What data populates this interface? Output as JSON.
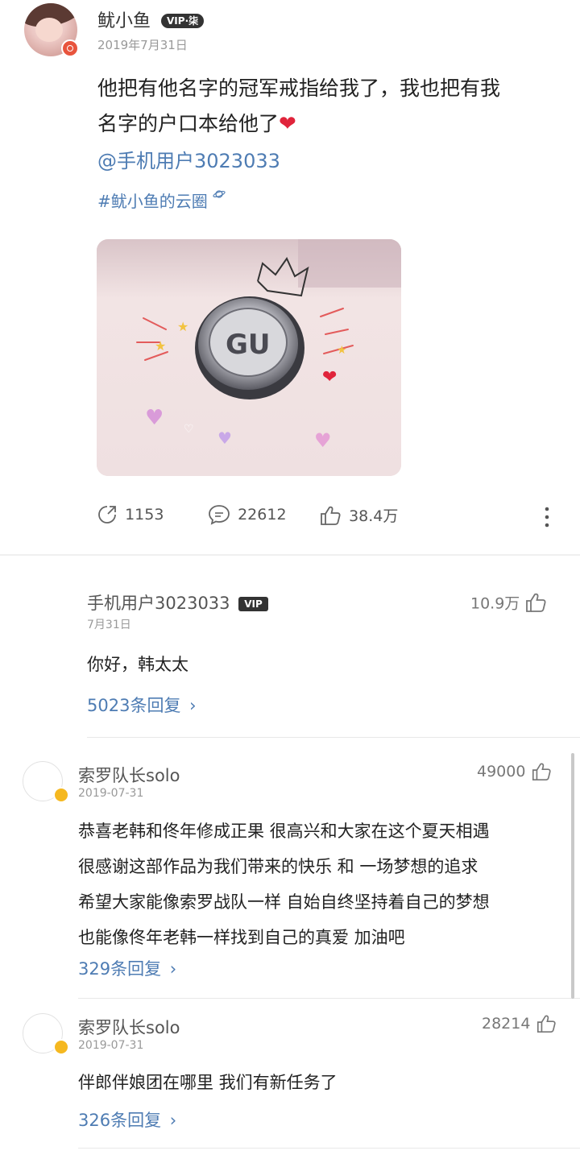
{
  "post": {
    "author": "鱿小鱼",
    "vip": "VIP·柒",
    "date": "2019年7月31日",
    "text_line1": "他把有他名字的冠军戒指给我了，我也把有我",
    "text_line2": "名字的户口本给他了",
    "mention": "@手机用户3023033",
    "topic": "#鱿小鱼的云圈",
    "repost_count": "1153",
    "comment_count": "22612",
    "like_count": "38.4万"
  },
  "comments": [
    {
      "name": "手机用户3023033",
      "vip": "VIP",
      "date": "7月31日",
      "likes": "10.9万",
      "text": "你好，韩太太",
      "replies": "5023条回复"
    },
    {
      "name": "索罗队长solo",
      "date": "2019-07-31",
      "likes": "49000",
      "line1": "恭喜老韩和佟年修成正果 很高兴和大家在这个夏天相遇",
      "line2": "很感谢这部作品为我们带来的快乐 和 一场梦想的追求",
      "line3": "希望大家能像索罗战队一样 自始自终坚持着自己的梦想",
      "line4": "也能像佟年老韩一样找到自己的真爱 加油吧",
      "replies": "329条回复"
    },
    {
      "name": "索罗队长solo",
      "date": "2019-07-31",
      "likes": "28214",
      "text": "伴郎伴娘团在哪里 我们有新任务了",
      "replies": "326条回复"
    }
  ]
}
